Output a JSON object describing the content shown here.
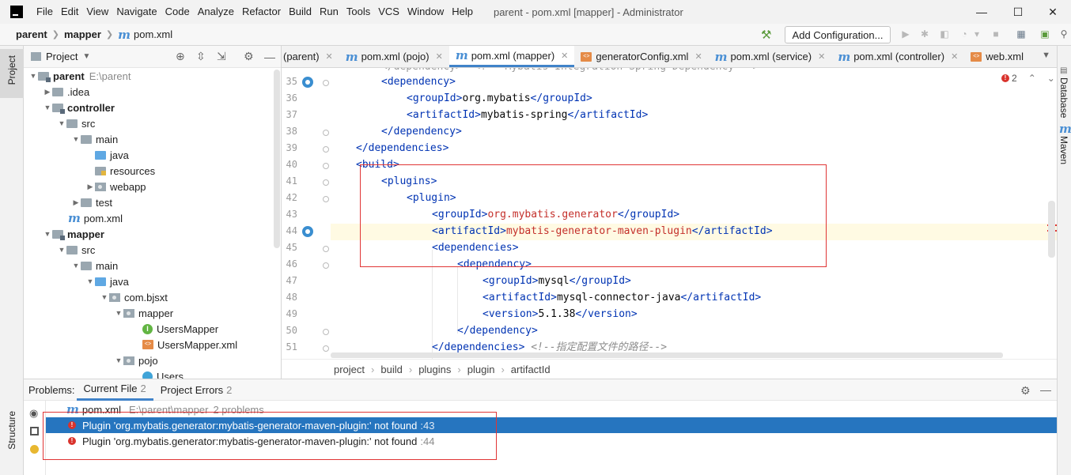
{
  "window": {
    "menu": [
      "File",
      "Edit",
      "View",
      "Navigate",
      "Code",
      "Analyze",
      "Refactor",
      "Build",
      "Run",
      "Tools",
      "VCS",
      "Window",
      "Help"
    ],
    "title": "parent - pom.xml [mapper] - Administrator",
    "minimize": "—",
    "maximize": "☐",
    "close": "✕"
  },
  "navbar": {
    "crumbs": [
      "parent",
      "mapper",
      "pom.xml"
    ],
    "add_config": "Add Configuration..."
  },
  "left_stripe": {
    "project": "Project",
    "structure": "Structure"
  },
  "right_stripe": {
    "database": "Database",
    "maven": "Maven"
  },
  "project_panel": {
    "title": "Project",
    "tree": [
      {
        "label": "parent",
        "extra": "E:\\parent"
      },
      {
        "label": ".idea"
      },
      {
        "label": "controller"
      },
      {
        "label": "src"
      },
      {
        "label": "main"
      },
      {
        "label": "java"
      },
      {
        "label": "resources"
      },
      {
        "label": "webapp"
      },
      {
        "label": "test"
      },
      {
        "label": "pom.xml"
      },
      {
        "label": "mapper"
      },
      {
        "label": "src"
      },
      {
        "label": "main"
      },
      {
        "label": "java"
      },
      {
        "label": "com.bjsxt"
      },
      {
        "label": "mapper"
      },
      {
        "label": "UsersMapper"
      },
      {
        "label": "UsersMapper.xml"
      },
      {
        "label": "pojo"
      },
      {
        "label": "Users"
      }
    ]
  },
  "tabs": [
    "(parent)",
    "pom.xml (pojo)",
    "pom.xml (mapper)",
    "generatorConfig.xml",
    "pom.xml (service)",
    "pom.xml (controller)",
    "web.xml"
  ],
  "editor": {
    "error_count": "2",
    "lines": [
      {
        "n": "35",
        "open": "<",
        "tag": "dependency",
        "close": ">"
      },
      {
        "n": "36",
        "a": "groupId",
        "val": "org.mybatis"
      },
      {
        "n": "37",
        "a": "artifactId",
        "val": "mybatis-spring"
      },
      {
        "n": "38",
        "end": "dependency"
      },
      {
        "n": "39",
        "end": "dependencies"
      },
      {
        "n": "40",
        "open": "<",
        "tag": "build",
        "close": ">"
      },
      {
        "n": "41",
        "open": "<",
        "tag": "plugins",
        "close": ">"
      },
      {
        "n": "42",
        "open": "<",
        "tag": "plugin",
        "close": ">"
      },
      {
        "n": "43",
        "a": "groupId",
        "val": "org.mybatis.generator"
      },
      {
        "n": "44",
        "a": "artifactId",
        "val": "mybatis-generator-maven-plugin"
      },
      {
        "n": "45",
        "open": "<",
        "tag": "dependencies",
        "close": ">"
      },
      {
        "n": "46",
        "open": "<",
        "tag": "dependency",
        "close": ">"
      },
      {
        "n": "47",
        "a": "groupId",
        "val": "mysql"
      },
      {
        "n": "48",
        "a": "artifactId",
        "val": "mysql-connector-java"
      },
      {
        "n": "49",
        "a": "version",
        "val": "5.1.38"
      },
      {
        "n": "50",
        "end": "dependency"
      },
      {
        "n": "51",
        "end": "dependencies",
        "comment": "<!--指定配置文件的路径-->"
      }
    ],
    "partial_top_comment": "</dependency>  <!-- Mybatis Integration Spring Dependency -->"
  },
  "code_breadcrumb": [
    "project",
    "build",
    "plugins",
    "plugin",
    "artifactId"
  ],
  "problems": {
    "label": "Problems:",
    "tabs": [
      {
        "label": "Current File",
        "count": "2"
      },
      {
        "label": "Project Errors",
        "count": "2"
      }
    ],
    "file": {
      "name": "pom.xml",
      "path": "E:\\parent\\mapper",
      "summary": "2 problems"
    },
    "items": [
      {
        "text": "Plugin 'org.mybatis.generator:mybatis-generator-maven-plugin:' not found",
        "loc": ":43"
      },
      {
        "text": "Plugin 'org.mybatis.generator:mybatis-generator-maven-plugin:' not found",
        "loc": ":44"
      }
    ]
  },
  "colors": {
    "accent": "#2675bf",
    "error": "#d9332d",
    "annotation": "#e03535",
    "xml_tag": "#0033b3",
    "unresolved": "#c4302b"
  }
}
